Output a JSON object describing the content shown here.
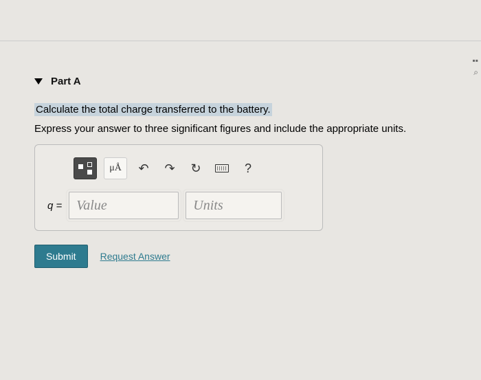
{
  "part": {
    "title": "Part A"
  },
  "question": {
    "highlighted": "Calculate the total charge transferred to the battery.",
    "instruction": "Express your answer to three significant figures and include the appropriate units."
  },
  "toolbar": {
    "units_symbol": "μÅ",
    "help_symbol": "?"
  },
  "input": {
    "variable": "q =",
    "value_placeholder": "Value",
    "units_placeholder": "Units"
  },
  "actions": {
    "submit": "Submit",
    "request": "Request Answer"
  }
}
